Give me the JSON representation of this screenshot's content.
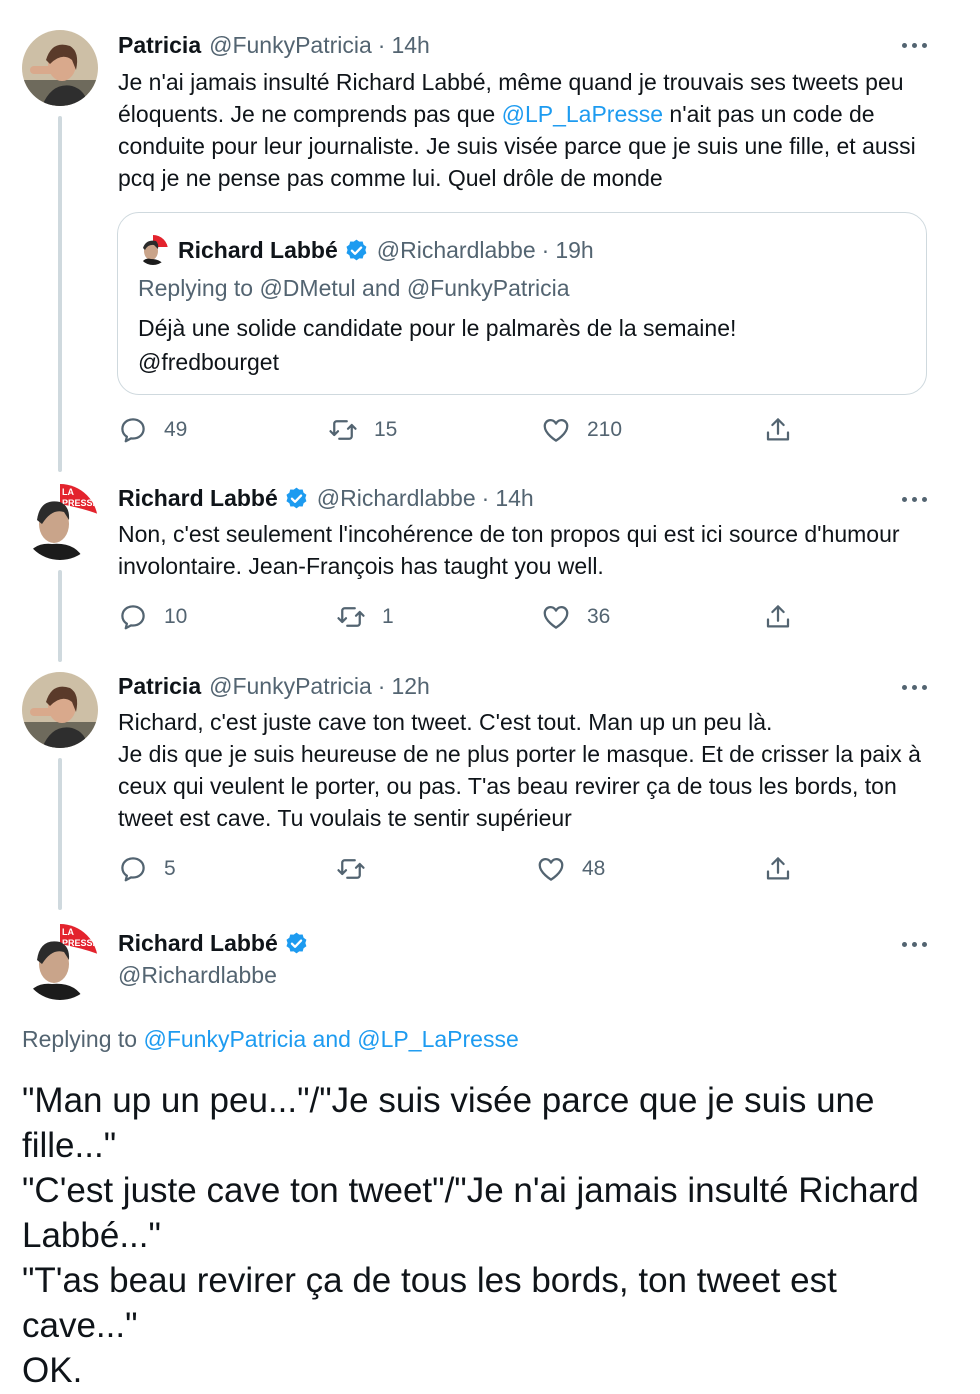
{
  "tweets": [
    {
      "name": "Patricia",
      "handle": "@FunkyPatricia",
      "separator": "·",
      "time": "14h",
      "text_before": "Je n'ai jamais insulté Richard Labbé, même quand je trouvais ses tweets peu éloquents. Je ne comprends pas que ",
      "mention": "@LP_LaPresse",
      "text_after": " n'ait pas un code de conduite pour leur journaliste. Je suis visée parce que je suis une fille, et aussi pcq je ne pense pas comme lui. Quel drôle de monde",
      "replies": "49",
      "retweets": "15",
      "likes": "210",
      "quote": {
        "name": "Richard Labbé",
        "handle": "@Richardlabbe",
        "separator": "·",
        "time": "19h",
        "replying": "Replying to @DMetul and @FunkyPatricia",
        "text_line1": "Déjà une solide candidate pour le palmarès de la semaine!",
        "text_line2": "@fredbourget"
      }
    },
    {
      "name": "Richard Labbé",
      "handle": "@Richardlabbe",
      "separator": "·",
      "time": "14h",
      "text": "Non, c'est seulement l'incohérence de ton propos qui est ici source d'humour involontaire. Jean-François has taught you well.",
      "replies": "10",
      "retweets": "1",
      "likes": "36"
    },
    {
      "name": "Patricia",
      "handle": "@FunkyPatricia",
      "separator": "·",
      "time": "12h",
      "text_line1": "Richard, c'est juste cave ton tweet. C'est tout. Man up un peu là.",
      "text_line2": "Je dis que je suis heureuse de ne plus porter le masque. Et de crisser la paix à ceux qui veulent le porter, ou pas. T'as beau revirer ça de tous les bords, ton tweet est cave. Tu voulais te sentir supérieur",
      "replies": "5",
      "retweets": "",
      "likes": "48"
    }
  ],
  "main_tweet": {
    "name": "Richard Labbé",
    "handle": "@Richardlabbe",
    "replying_label": "Replying to ",
    "replying_mentions": "@FunkyPatricia and @LP_LaPresse",
    "lines": [
      "\"Man up un peu...\"/\"Je suis visée parce que je suis une fille...\"",
      "\"C'est juste cave ton tweet\"/\"Je n'ai jamais insulté Richard Labbé...\"",
      "\"T'as beau revirer ça de tous les bords, ton tweet est cave...\"",
      "OK."
    ]
  },
  "avatar_badge": "LA PRESSE",
  "colors": {
    "accent": "#1d9bf0",
    "muted": "#536471",
    "text": "#0f1419",
    "thread_line": "#cfd9de",
    "lapresse_red": "#e3232d"
  }
}
